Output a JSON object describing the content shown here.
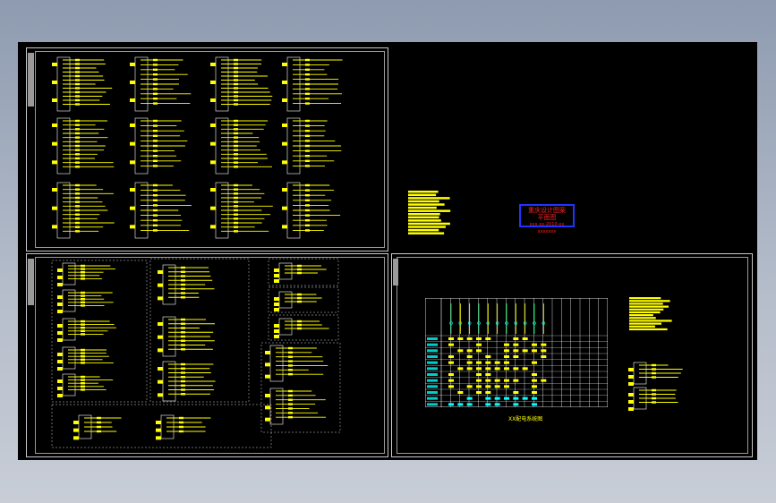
{
  "viewer": {
    "background": "#000000",
    "line_color": "#ffff00",
    "frame_color": "#c8c8c8"
  },
  "sheets": [
    {
      "id": "top-left",
      "content": "distribution-system-diagrams"
    },
    {
      "id": "top-right",
      "content": "notes-and-stamp"
    },
    {
      "id": "bottom-left",
      "content": "distribution-box-diagrams"
    },
    {
      "id": "bottom-right",
      "content": "schedule-table"
    }
  ],
  "stamp": {
    "line1": "重庆设计图案",
    "line2": "平面图",
    "line3": "xxx  xx-2010-xx  xxxxxxx",
    "border_color": "#2233ff",
    "text_color": "#ff2222"
  },
  "table_caption": "XX配电系统图"
}
